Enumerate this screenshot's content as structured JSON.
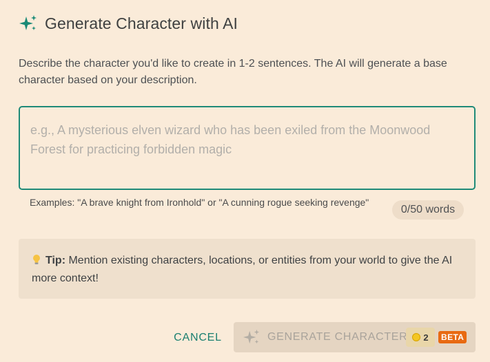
{
  "dialog": {
    "title": "Generate Character with AI",
    "description": "Describe the character you'd like to create in 1-2 sentences. The AI will generate a base character based on your description.",
    "input": {
      "value": "",
      "placeholder": "e.g., A mysterious elven wizard who has been exiled from the Moonwood Forest for practicing forbidden magic"
    },
    "examples": "Examples: \"A brave knight from Ironhold\" or \"A cunning rogue seeking revenge\"",
    "word_count": "0/50 words",
    "tip": {
      "label": "Tip:",
      "text": " Mention existing characters, locations, or entities from your world to give the AI more context!"
    },
    "actions": {
      "cancel_label": "CANCEL",
      "generate_label": "GENERATE CHARACTER",
      "credit_cost": "2",
      "beta_label": "BETA"
    }
  },
  "icons": {
    "title_icon": "sparkles-icon",
    "tip_icon": "lightbulb-icon",
    "generate_icon": "sparkles-icon",
    "credit_icon": "coin-icon"
  },
  "colors": {
    "background": "#faebd9",
    "accent": "#1e8a78",
    "beta": "#e86a12"
  }
}
